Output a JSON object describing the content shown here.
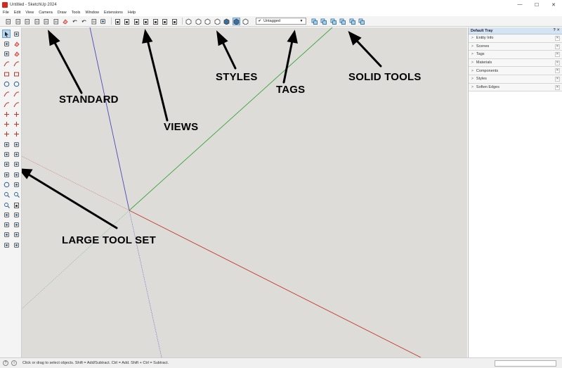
{
  "window": {
    "title": "Untitled - SketchUp 2024",
    "minimize": "—",
    "maximize": "☐",
    "close": "✕"
  },
  "menu": [
    "File",
    "Edit",
    "View",
    "Camera",
    "Draw",
    "Tools",
    "Window",
    "Extensions",
    "Help"
  ],
  "toolbar": {
    "tag_select_value": "Untagged",
    "standard_tools": [
      "new-icon",
      "open-icon",
      "save-icon",
      "cut-icon",
      "copy-icon",
      "paste-icon",
      "erase-icon",
      "undo-icon",
      "redo-icon",
      "print-icon",
      "model-info-icon"
    ],
    "view_tools": [
      "iso-view-icon",
      "top-view-icon",
      "front-view-icon",
      "right-view-icon",
      "back-view-icon",
      "left-view-icon",
      "bottom-view-icon"
    ],
    "style_tools": [
      "xray-icon",
      "back-edges-icon",
      "wireframe-icon",
      "hidden-line-icon",
      "shaded-icon",
      "shaded-textures-icon",
      "monochrome-icon"
    ],
    "solid_tools": [
      "outer-shell-icon",
      "intersect-icon",
      "union-icon",
      "subtract-icon",
      "trim-icon",
      "split-icon"
    ]
  },
  "left_tools": [
    "select-icon",
    "lasso-icon",
    "paint-icon",
    "eraser-icon",
    "tag-icon",
    "eraser2-icon",
    "line-icon",
    "freehand-icon",
    "rectangle-icon",
    "rotated-rect-icon",
    "circle-icon",
    "polygon-icon",
    "arc-icon",
    "two-point-arc-icon",
    "three-point-arc-icon",
    "pie-icon",
    "move-icon",
    "push-pull-icon",
    "rotate-icon",
    "follow-me-icon",
    "scale-icon",
    "offset-icon",
    "tape-measure-icon",
    "dimension-icon",
    "protractor-icon",
    "text-icon",
    "axes-icon",
    "3d-text-icon",
    "section-plane-icon",
    "walk-icon",
    "orbit-icon",
    "pan-icon",
    "zoom-icon",
    "zoom-window-icon",
    "zoom-extents-icon",
    "previous-view-icon",
    "position-camera-icon",
    "look-around-icon",
    "walk2-icon",
    "section-fill-icon",
    "sandbox-icon",
    "smoove-icon",
    "stamp-icon",
    "drape-icon"
  ],
  "callouts": {
    "standard": "STANDARD",
    "views": "VIEWS",
    "styles": "STYLES",
    "tags": "TAGS",
    "solid_tools": "SOLID TOOLS",
    "large_tool_set": "LARGE TOOL SET"
  },
  "tray": {
    "title": "Default Tray",
    "header_icons": "?  ✕",
    "panels": [
      "Entity Info",
      "Scenes",
      "Tags",
      "Materials",
      "Components",
      "Styles",
      "Soften Edges"
    ]
  },
  "status": {
    "icon1": "?",
    "icon2": "i",
    "text": "Click or drag to select objects. Shift = Add/Subtract. Ctrl = Add. Shift + Ctrl = Subtract."
  },
  "colors": {
    "viewport_bg": "#dedcd8",
    "axis_red": "#c0392b",
    "axis_green": "#3aa63a",
    "axis_blue": "#4a4ab8",
    "tray_header": "#d4e4f3",
    "active_button": "#b8d6ee"
  }
}
